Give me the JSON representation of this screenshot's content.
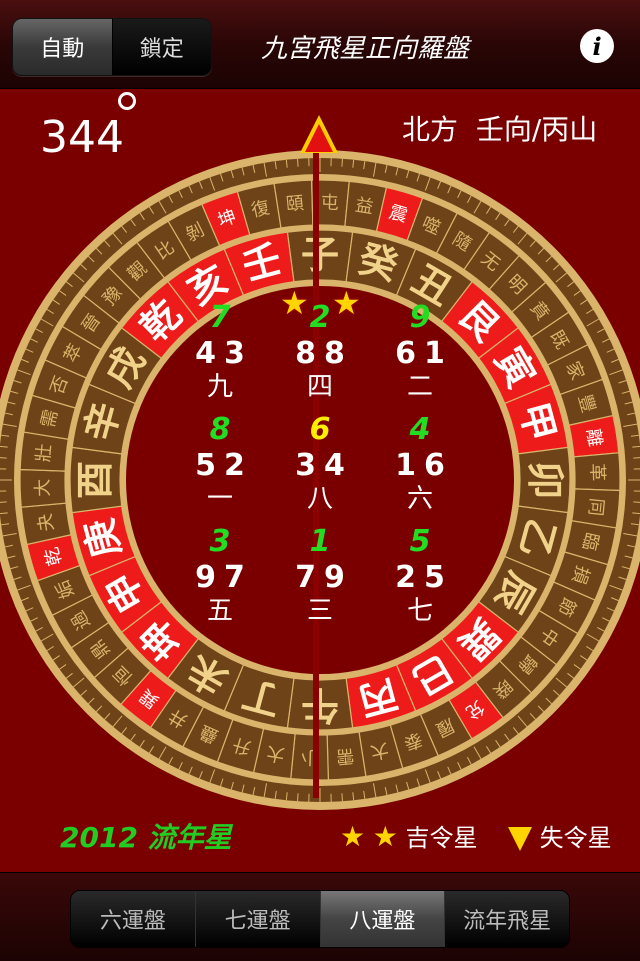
{
  "header": {
    "mode_auto": "自動",
    "mode_lock": "鎖定",
    "title": "九宮飛星正向羅盤",
    "info_icon": "info-icon",
    "info_glyph": "i"
  },
  "reading": {
    "degree": "344",
    "direction": "北方",
    "facing": "壬向/丙山"
  },
  "compass": {
    "inner_ring": [
      "子",
      "癸",
      "丑",
      "艮",
      "寅",
      "甲",
      "卯",
      "乙",
      "辰",
      "巽",
      "巳",
      "丙",
      "午",
      "丁",
      "未",
      "坤",
      "申",
      "庚",
      "酉",
      "辛",
      "戌",
      "乾",
      "亥",
      "壬"
    ],
    "inner_red": [
      3,
      4,
      5,
      9,
      10,
      11,
      15,
      16,
      17,
      21,
      22,
      23
    ],
    "outer_ring": [
      "復",
      "頤",
      "屯",
      "益",
      "震",
      "噬",
      "隨",
      "无",
      "明",
      "賁",
      "既",
      "家",
      "豐",
      "離",
      "革",
      "同",
      "臨",
      "損",
      "節",
      "中",
      "歸",
      "睽",
      "兌",
      "履",
      "泰",
      "大",
      "需",
      "小",
      "大",
      "升",
      "蠱",
      "井",
      "巽",
      "恒",
      "鼎",
      "過",
      "姤",
      "乾",
      "夬",
      "大",
      "壯",
      "需",
      "否",
      "萃",
      "晉",
      "豫",
      "觀",
      "比",
      "剝",
      "坤"
    ],
    "outer_red_chars": [
      "坤",
      "震",
      "離",
      "兌",
      "乾",
      "巽",
      "艮",
      "坎"
    ],
    "colors": {
      "gold": "#d9b46a",
      "brown": "#6e4318",
      "red": "#ee1b1b",
      "bg": "#7a0000"
    }
  },
  "grid": [
    {
      "year": "7",
      "year_color": "#22dd22",
      "numbers": "43",
      "palace": "九"
    },
    {
      "year": "2",
      "year_color": "#22dd22",
      "numbers": "88",
      "palace": "四"
    },
    {
      "year": "9",
      "year_color": "#22dd22",
      "numbers": "61",
      "palace": "二"
    },
    {
      "year": "8",
      "year_color": "#22dd22",
      "numbers": "52",
      "palace": "一"
    },
    {
      "year": "6",
      "year_color": "#ffee00",
      "numbers": "34",
      "palace": "八"
    },
    {
      "year": "4",
      "year_color": "#22dd22",
      "numbers": "16",
      "palace": "六"
    },
    {
      "year": "3",
      "year_color": "#22dd22",
      "numbers": "97",
      "palace": "五"
    },
    {
      "year": "1",
      "year_color": "#22dd22",
      "numbers": "79",
      "palace": "三"
    },
    {
      "year": "5",
      "year_color": "#22dd22",
      "numbers": "25",
      "palace": "七"
    }
  ],
  "footer": {
    "year_label": "2012 流年星",
    "good_star": "吉令星",
    "bad_star": "失令星",
    "star_glyph": "★"
  },
  "tabs": [
    "六運盤",
    "七運盤",
    "八運盤",
    "流年飛星"
  ],
  "selected_tab": 2
}
